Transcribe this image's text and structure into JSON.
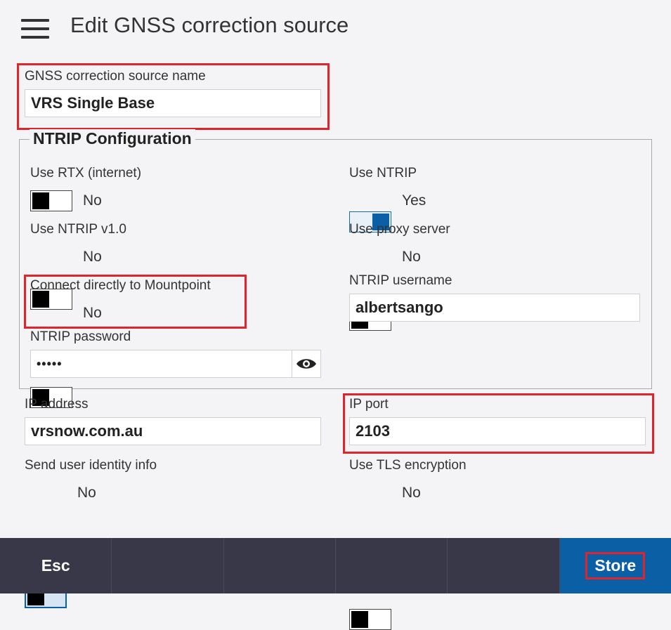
{
  "header": {
    "title": "Edit GNSS correction source",
    "menu_icon": "hamburger-menu-icon"
  },
  "source_name": {
    "label": "GNSS correction source name",
    "value": "VRS Single Base"
  },
  "ntrip": {
    "legend": "NTRIP Configuration",
    "use_rtx": {
      "label": "Use RTX (internet)",
      "value": "No"
    },
    "use_ntrip": {
      "label": "Use NTRIP",
      "value": "Yes"
    },
    "use_ntrip_v1": {
      "label": "Use NTRIP v1.0",
      "value": "No"
    },
    "use_proxy": {
      "label": "Use proxy server",
      "value": "No"
    },
    "connect_mountpoint": {
      "label": "Connect directly to Mountpoint",
      "value": "No"
    },
    "username": {
      "label": "NTRIP username",
      "value": "albertsango"
    },
    "password": {
      "label": "NTRIP password",
      "value": "•••••",
      "icon": "eye-icon"
    }
  },
  "ip_address": {
    "label": "IP address",
    "value": "vrsnow.com.au"
  },
  "ip_port": {
    "label": "IP port",
    "value": "2103"
  },
  "send_identity": {
    "label": "Send user identity info",
    "value": "No"
  },
  "use_tls": {
    "label": "Use TLS encryption",
    "value": "No"
  },
  "footer": {
    "esc_label": "Esc",
    "store_label": "Store"
  },
  "colors": {
    "accent": "#0b5fa5",
    "highlight": "#e0242c",
    "footer_bg": "#383848"
  }
}
